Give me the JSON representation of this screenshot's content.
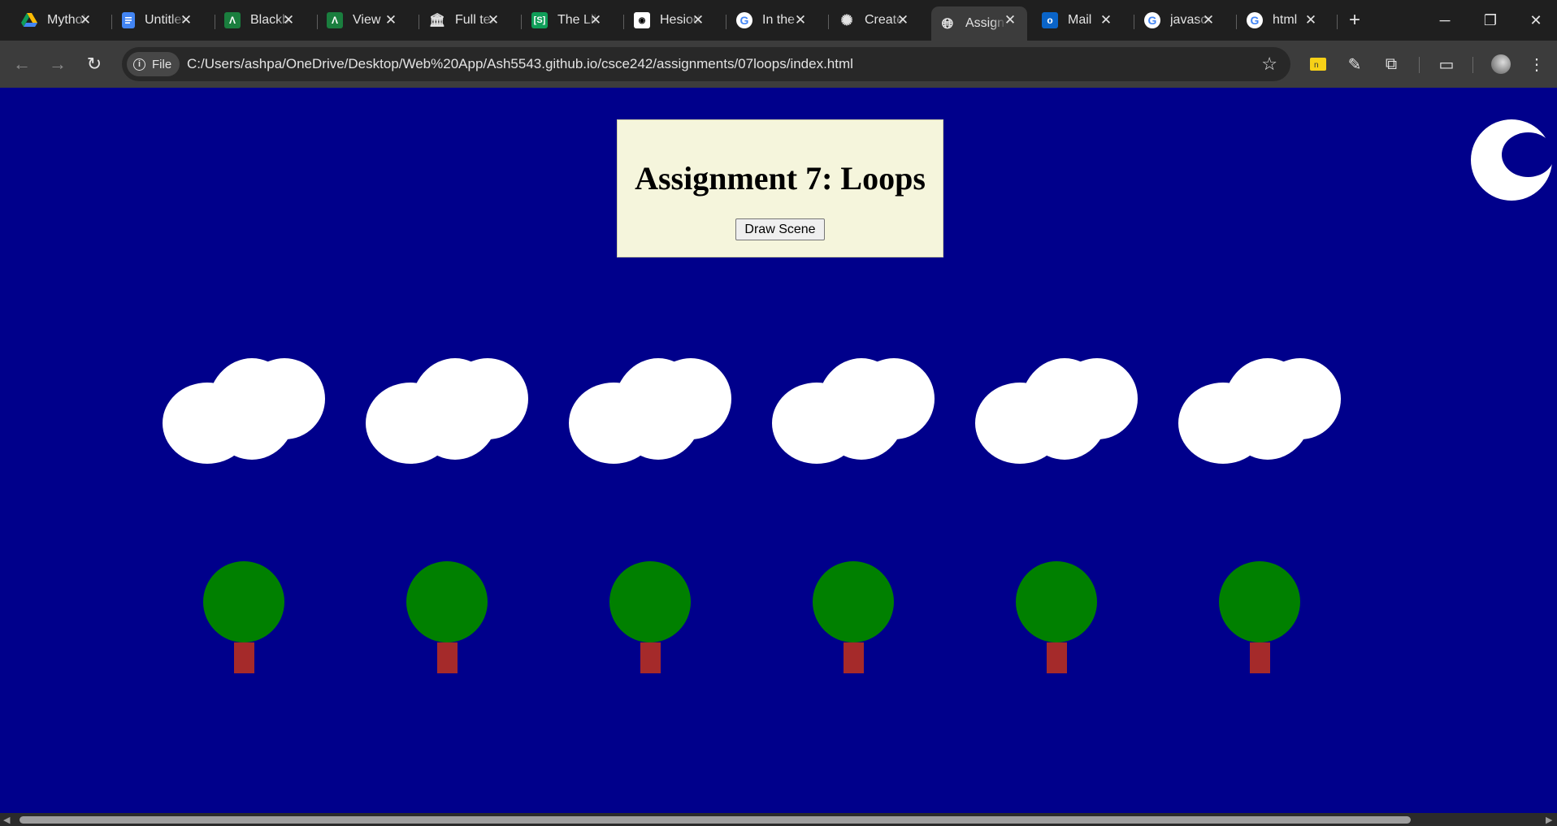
{
  "browser": {
    "tabs": [
      {
        "title": "Mythology",
        "icon": "google-drive-icon",
        "color": "#fbbc04"
      },
      {
        "title": "Untitled",
        "icon": "google-docs-icon",
        "color": "#4285f4"
      },
      {
        "title": "Blackboard",
        "icon": "blackboard-icon",
        "color": "#1a7e3e"
      },
      {
        "title": "View",
        "icon": "blackboard-icon",
        "color": "#1a7e3e"
      },
      {
        "title": "Full text",
        "icon": "library-icon",
        "color": "#e3e3e3"
      },
      {
        "title": "The Library",
        "icon": "sheets-icon",
        "color": "#0f9d58"
      },
      {
        "title": "Hesiod",
        "icon": "site-icon",
        "color": "#ffffff"
      },
      {
        "title": "In the",
        "icon": "google-icon",
        "color": "#ffffff"
      },
      {
        "title": "Create",
        "icon": "openai-icon",
        "color": "#e3e3e3"
      },
      {
        "title": "Assignment",
        "icon": "globe-icon",
        "color": "#e3e3e3",
        "active": true
      },
      {
        "title": "Mail",
        "icon": "outlook-icon",
        "color": "#0a64c8"
      },
      {
        "title": "javascript",
        "icon": "google-icon",
        "color": "#ffffff"
      },
      {
        "title": "html",
        "icon": "google-icon",
        "color": "#ffffff"
      }
    ],
    "new_tab_label": "+",
    "omnibox": {
      "scheme_chip": "File",
      "url": "C:/Users/ashpa/OneDrive/Desktop/Web%20App/Ash5543.github.io/csce242/assignments/07loops/index.html"
    }
  },
  "page": {
    "heading": "Assignment 7: Loops",
    "button_label": "Draw Scene",
    "background_color": "#00008b",
    "panel_color": "#f5f5dc",
    "moon_color": "#ffffff",
    "cloud_color": "#ffffff",
    "tree_color": "#008000",
    "trunk_color": "#a52a2a"
  }
}
